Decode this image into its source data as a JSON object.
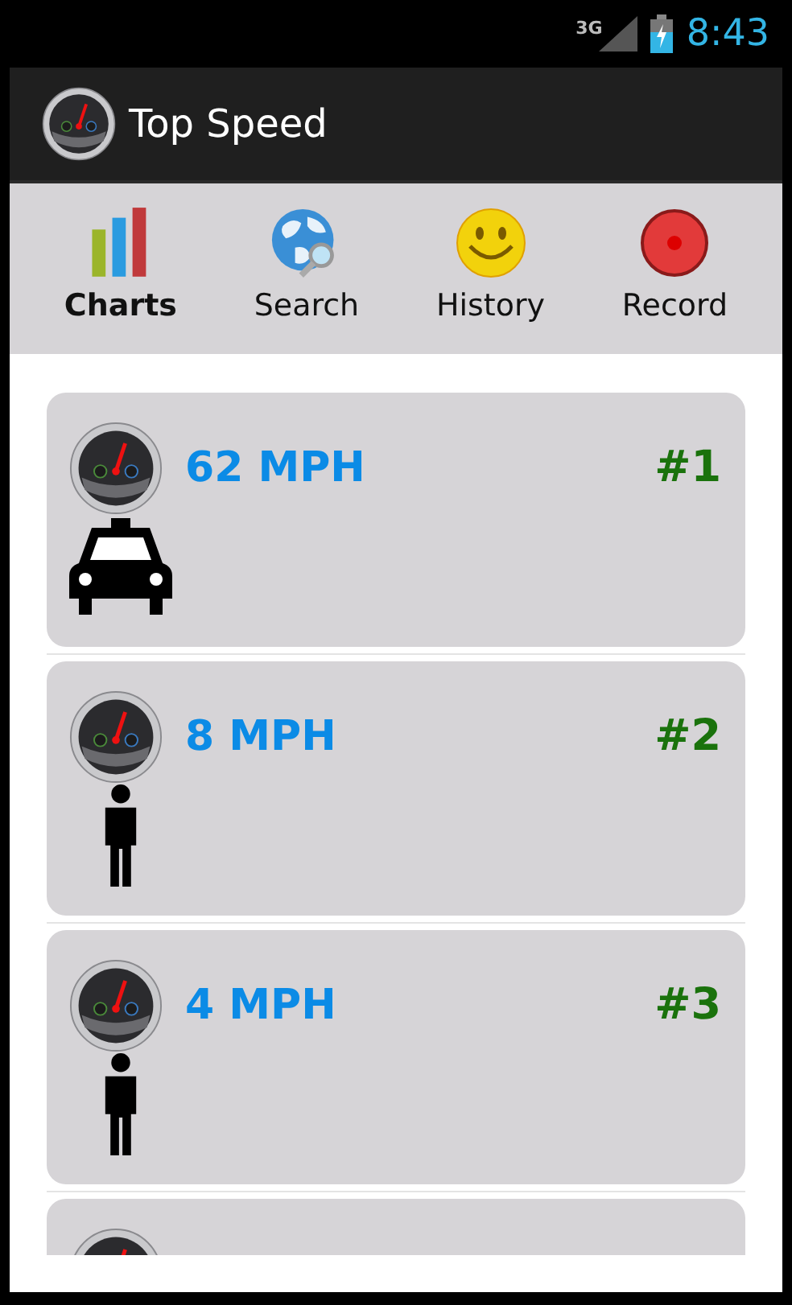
{
  "status_bar": {
    "network": "3G",
    "time": "8:43"
  },
  "action_bar": {
    "title": "Top Speed"
  },
  "tabs": [
    {
      "label": "Charts",
      "kind": "charts",
      "selected": true
    },
    {
      "label": "Search",
      "kind": "search",
      "selected": false
    },
    {
      "label": "History",
      "kind": "history",
      "selected": false
    },
    {
      "label": "Record",
      "kind": "record",
      "selected": false
    }
  ],
  "entries": [
    {
      "speed": "62 MPH",
      "rank": "#1",
      "kind": "car"
    },
    {
      "speed": "8 MPH",
      "rank": "#2",
      "kind": "person"
    },
    {
      "speed": "4 MPH",
      "rank": "#3",
      "kind": "person"
    }
  ],
  "more_entries_below": true
}
